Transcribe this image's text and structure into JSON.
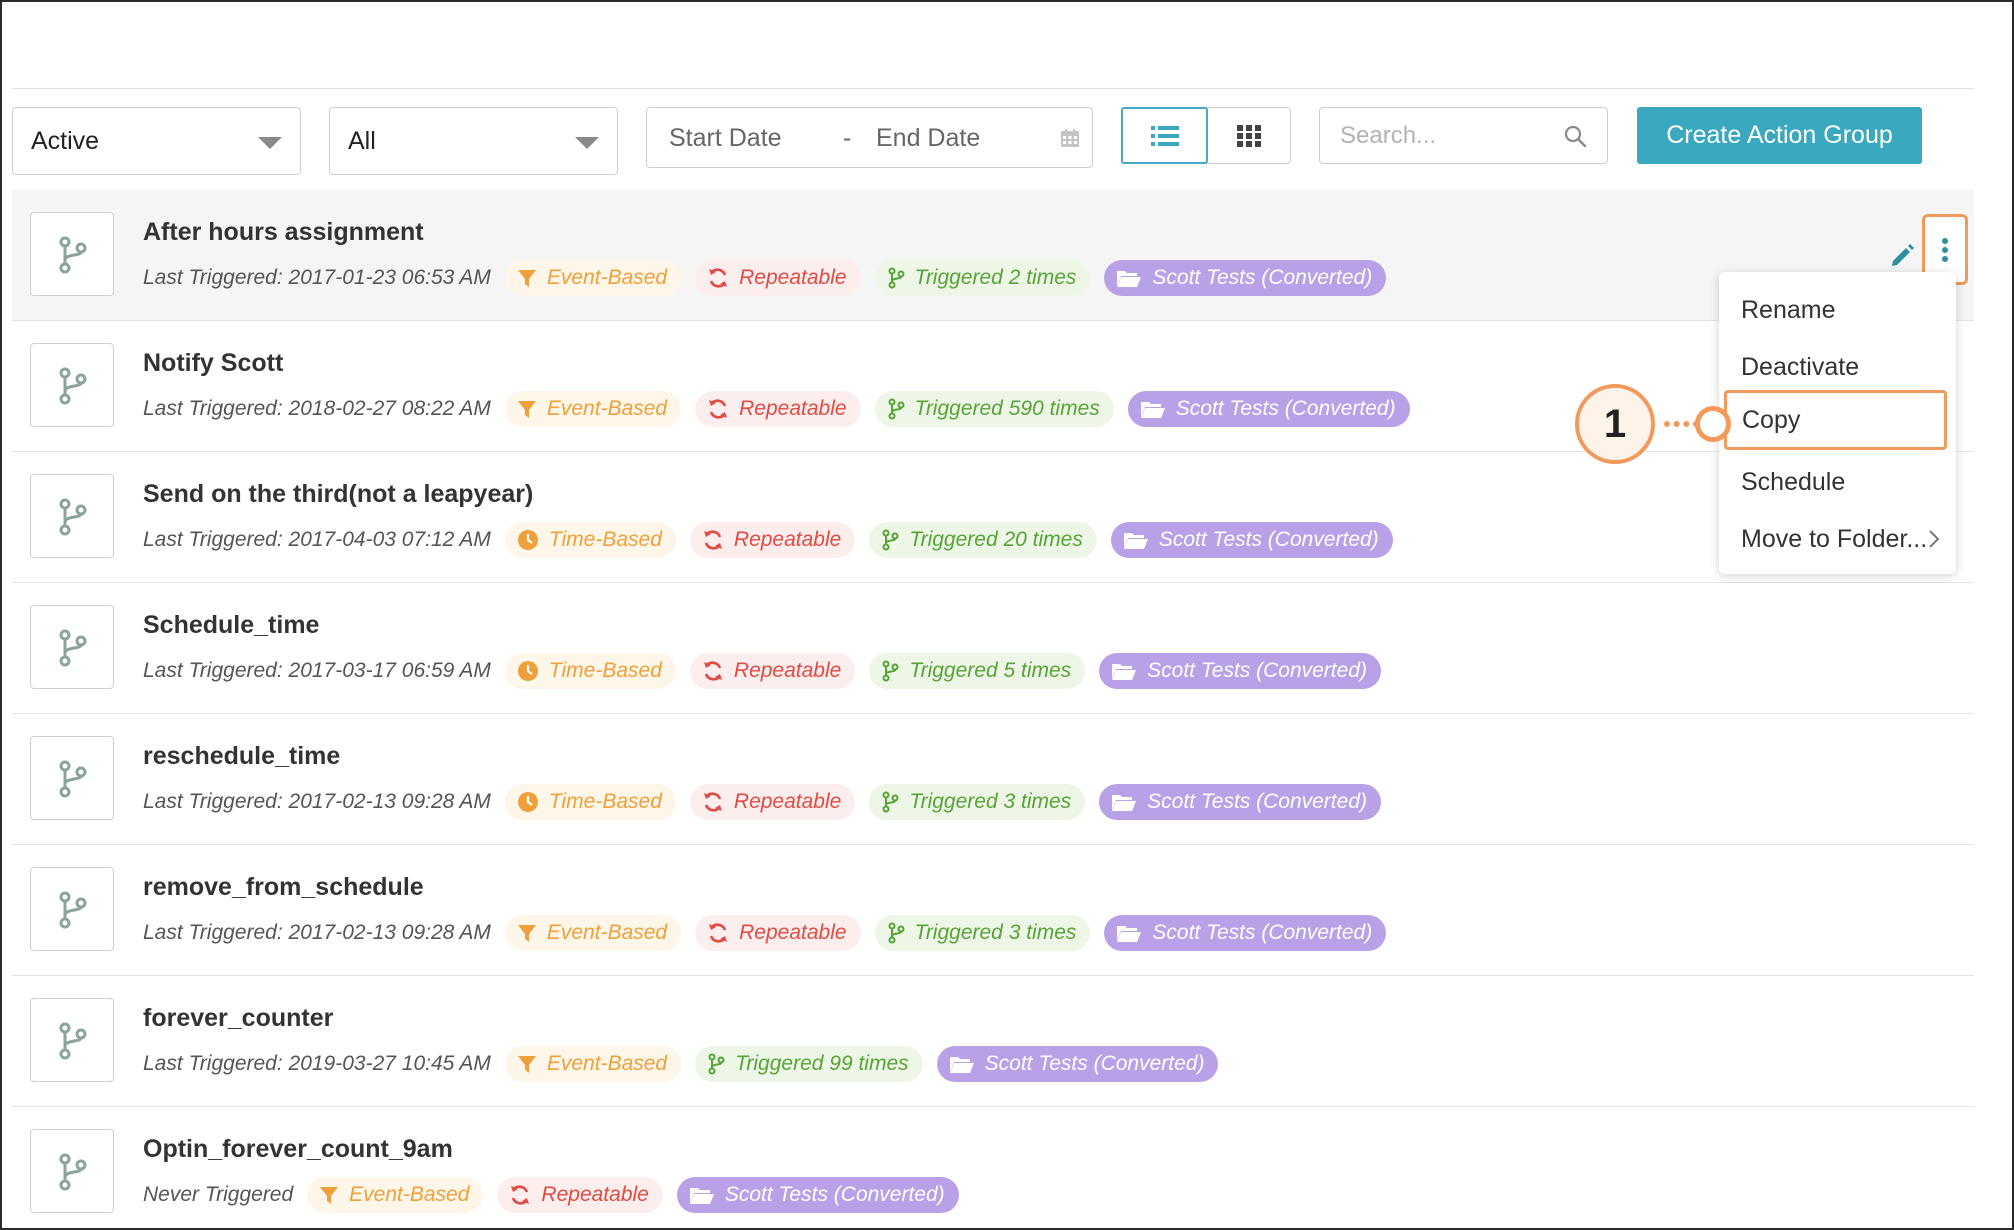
{
  "filters": {
    "status": {
      "selected": "Active"
    },
    "type": {
      "selected": "All"
    },
    "date_range": {
      "start_placeholder": "Start Date",
      "separator": "-",
      "end_placeholder": "End Date"
    },
    "search": {
      "placeholder": "Search..."
    },
    "create_button": "Create Action Group"
  },
  "view_modes": {
    "active": "list",
    "options": [
      "list",
      "grid"
    ]
  },
  "rows": [
    {
      "title": "After hours assignment",
      "last_triggered": "Last Triggered: 2017-01-23 06:53 AM",
      "type": "Event-Based",
      "repeatable": "Repeatable",
      "triggered": "Triggered 2 times",
      "folder": "Scott Tests (Converted)"
    },
    {
      "title": "Notify Scott",
      "last_triggered": "Last Triggered: 2018-02-27 08:22 AM",
      "type": "Event-Based",
      "repeatable": "Repeatable",
      "triggered": "Triggered 590 times",
      "folder": "Scott Tests (Converted)"
    },
    {
      "title": "Send on the third(not a leapyear)",
      "last_triggered": "Last Triggered: 2017-04-03 07:12 AM",
      "type": "Time-Based",
      "repeatable": "Repeatable",
      "triggered": "Triggered 20 times",
      "folder": "Scott Tests (Converted)"
    },
    {
      "title": "Schedule_time",
      "last_triggered": "Last Triggered: 2017-03-17 06:59 AM",
      "type": "Time-Based",
      "repeatable": "Repeatable",
      "triggered": "Triggered 5 times",
      "folder": "Scott Tests (Converted)"
    },
    {
      "title": "reschedule_time",
      "last_triggered": "Last Triggered: 2017-02-13 09:28 AM",
      "type": "Time-Based",
      "repeatable": "Repeatable",
      "triggered": "Triggered 3 times",
      "folder": "Scott Tests (Converted)"
    },
    {
      "title": "remove_from_schedule",
      "last_triggered": "Last Triggered: 2017-02-13 09:28 AM",
      "type": "Event-Based",
      "repeatable": "Repeatable",
      "triggered": "Triggered 3 times",
      "folder": "Scott Tests (Converted)"
    },
    {
      "title": "forever_counter",
      "last_triggered": "Last Triggered: 2019-03-27 10:45 AM",
      "type": "Event-Based",
      "triggered": "Triggered 99 times",
      "folder": "Scott Tests (Converted)"
    },
    {
      "title": "Optin_forever_count_9am",
      "last_triggered": "Never Triggered",
      "type": "Event-Based",
      "repeatable": "Repeatable",
      "folder": "Scott Tests (Converted)"
    }
  ],
  "context_menu": {
    "items": [
      "Rename",
      "Deactivate",
      "Copy",
      "Schedule",
      "Move to Folder..."
    ],
    "highlighted": "Copy"
  },
  "callout": {
    "number": "1"
  },
  "colors": {
    "accent": "#3aa8bf",
    "event_type": "#f0a03a",
    "repeatable": "#e14b43",
    "triggered": "#55a434",
    "folder": "#b8a1e6",
    "callout": "#f29a5b"
  },
  "icons": {
    "row": "branch-icon",
    "event": "filter-icon",
    "time": "clock-icon",
    "repeatable": "refresh-icon",
    "triggered": "branch-icon",
    "folder": "folder-icon"
  }
}
